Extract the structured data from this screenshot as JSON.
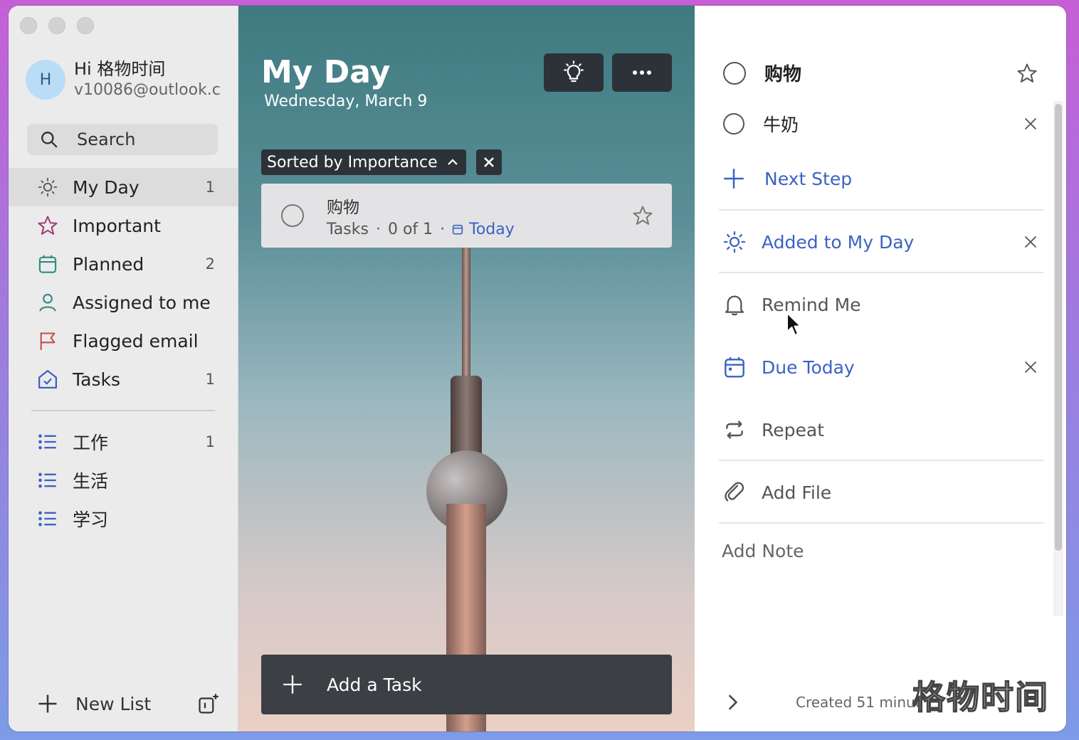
{
  "sidebar": {
    "profile": {
      "avatar": "H",
      "name": "Hi 格物时间",
      "email": "v10086@outlook.c"
    },
    "search_label": "Search",
    "items": [
      {
        "label": "My Day",
        "count": "1",
        "icon": "sun-icon",
        "color": "#555555"
      },
      {
        "label": "Important",
        "count": "",
        "icon": "star-icon",
        "color": "#a0407a"
      },
      {
        "label": "Planned",
        "count": "2",
        "icon": "calendar-icon",
        "color": "#2f8a83"
      },
      {
        "label": "Assigned to me",
        "count": "",
        "icon": "person-icon",
        "color": "#2f8a83"
      },
      {
        "label": "Flagged email",
        "count": "",
        "icon": "flag-icon",
        "color": "#c0504d"
      },
      {
        "label": "Tasks",
        "count": "1",
        "icon": "home-icon",
        "color": "#3b62c4"
      }
    ],
    "lists": [
      {
        "label": "工作",
        "count": "1"
      },
      {
        "label": "生活",
        "count": ""
      },
      {
        "label": "学习",
        "count": ""
      }
    ],
    "new_list_label": "New List"
  },
  "main": {
    "title": "My Day",
    "date": "Wednesday, March 9",
    "sort_label": "Sorted by Importance",
    "task": {
      "title": "购物",
      "list": "Tasks",
      "steps": "0 of 1",
      "due": "Today"
    },
    "add_task_label": "Add a Task"
  },
  "detail": {
    "task_title": "购物",
    "step_title": "牛奶",
    "next_step_label": "Next Step",
    "my_day_label": "Added to My Day",
    "remind_label": "Remind Me",
    "due_label": "Due Today",
    "repeat_label": "Repeat",
    "add_file_label": "Add File",
    "add_note_label": "Add Note",
    "created_label": "Created 51 minut"
  },
  "watermark": "格物时间",
  "colors": {
    "accent": "#3b62c4",
    "dark_button": "#2c3238"
  }
}
